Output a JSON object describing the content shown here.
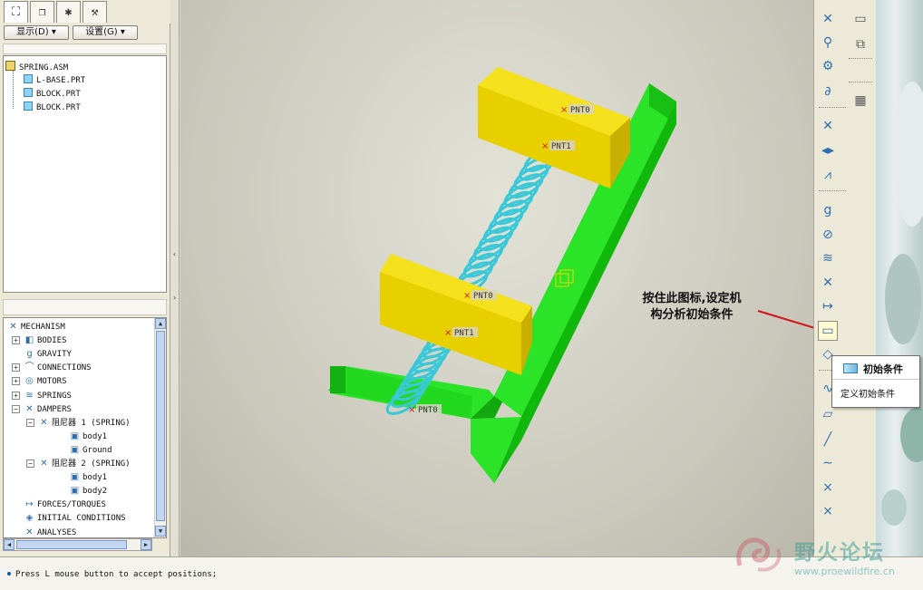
{
  "left_panel": {
    "tabs": [
      {
        "icon": "tree-icon",
        "glyph": "⛶"
      },
      {
        "icon": "layers-icon",
        "glyph": "❐"
      },
      {
        "icon": "star-folder-icon",
        "glyph": "✱"
      },
      {
        "icon": "tools-icon",
        "glyph": "⚒"
      }
    ],
    "show_button": "显示(D) ▾",
    "settings_button": "设置(G) ▾",
    "model_tree": [
      {
        "label": "SPRING.ASM",
        "type": "assembly"
      },
      {
        "label": "L-BASE.PRT",
        "type": "part"
      },
      {
        "label": "BLOCK.PRT",
        "type": "part"
      },
      {
        "label": "BLOCK.PRT",
        "type": "part"
      }
    ],
    "mechanism_tree": [
      {
        "label": "MECHANISM",
        "icon": "✕",
        "depth": 0,
        "expander": ""
      },
      {
        "label": "BODIES",
        "icon": "◧",
        "depth": 1,
        "expander": "+"
      },
      {
        "label": "GRAVITY",
        "icon": "g",
        "depth": 1,
        "expander": ""
      },
      {
        "label": "CONNECTIONS",
        "icon": "⌒",
        "depth": 1,
        "expander": "+"
      },
      {
        "label": "MOTORS",
        "icon": "◎",
        "depth": 1,
        "expander": "+"
      },
      {
        "label": "SPRINGS",
        "icon": "≋",
        "depth": 1,
        "expander": "+"
      },
      {
        "label": "DAMPERS",
        "icon": "✕",
        "depth": 1,
        "expander": "−"
      },
      {
        "label": "阻尼器 1 (SPRING)",
        "icon": "✕",
        "depth": 2,
        "expander": "−"
      },
      {
        "label": "body1",
        "icon": "▣",
        "depth": 3,
        "expander": ""
      },
      {
        "label": "Ground",
        "icon": "▣",
        "depth": 3,
        "expander": ""
      },
      {
        "label": "阻尼器 2 (SPRING)",
        "icon": "✕",
        "depth": 2,
        "expander": "−"
      },
      {
        "label": "body1",
        "icon": "▣",
        "depth": 3,
        "expander": ""
      },
      {
        "label": "body2",
        "icon": "▣",
        "depth": 3,
        "expander": ""
      },
      {
        "label": "FORCES/TORQUES",
        "icon": "↦",
        "depth": 1,
        "expander": ""
      },
      {
        "label": "INITIAL CONDITIONS",
        "icon": "◈",
        "depth": 1,
        "expander": ""
      },
      {
        "label": "ANALYSES",
        "icon": "✕",
        "depth": 1,
        "expander": ""
      }
    ]
  },
  "viewport": {
    "point_labels": [
      "PNT0",
      "PNT1",
      "PNT0",
      "PNT1",
      "PNT0"
    ],
    "annotation_line1": "按住此图标,设定机",
    "annotation_line2": "构分析初始条件",
    "colors": {
      "base": "#22e01c",
      "block": "#f5d800",
      "spring": "#39c8d8",
      "arrow": "#d0141c"
    }
  },
  "right_toolbar": {
    "tools": [
      {
        "icon": "mechanism-icon",
        "glyph": "✕"
      },
      {
        "icon": "gravity-icon",
        "glyph": "⚲"
      },
      {
        "icon": "gears-icon",
        "glyph": "⚙"
      },
      {
        "icon": "connect-icon",
        "glyph": "∂"
      },
      {
        "icon": "run-mechanism-icon",
        "glyph": "✕"
      },
      {
        "icon": "play-arrows-icon",
        "glyph": "◂▸"
      },
      {
        "icon": "measure-graph-icon",
        "glyph": "⩘"
      },
      {
        "icon": "gravity-g-icon",
        "glyph": "g"
      },
      {
        "icon": "servo-motor-icon",
        "glyph": "⊘"
      },
      {
        "icon": "spring-icon",
        "glyph": "≋"
      },
      {
        "icon": "damper-icon",
        "glyph": "✕"
      },
      {
        "icon": "force-icon",
        "glyph": "↦"
      },
      {
        "icon": "initial-conditions-icon",
        "glyph": "▭"
      },
      {
        "icon": "mass-properties-icon",
        "glyph": "◇"
      },
      {
        "icon": "wave-icon",
        "glyph": "∿"
      },
      {
        "icon": "plane-icon",
        "glyph": "▱"
      },
      {
        "icon": "axis-icon",
        "glyph": "╱"
      },
      {
        "icon": "curve-icon",
        "glyph": "∼"
      },
      {
        "icon": "point-icon",
        "glyph": "×"
      },
      {
        "icon": "csys-icon",
        "glyph": "⨯"
      }
    ],
    "second_column": [
      {
        "icon": "datum-plane-tool-icon",
        "glyph": "▭"
      },
      {
        "icon": "copy-icon",
        "glyph": "⧉"
      },
      {
        "icon": "table-icon",
        "glyph": "▦"
      }
    ]
  },
  "tooltip": {
    "title": "初始条件",
    "description": "定义初始条件"
  },
  "status": {
    "message": "Press L mouse button to accept positions;"
  },
  "watermark": {
    "title": "野火论坛",
    "url": "www.proewildfire.cn"
  }
}
